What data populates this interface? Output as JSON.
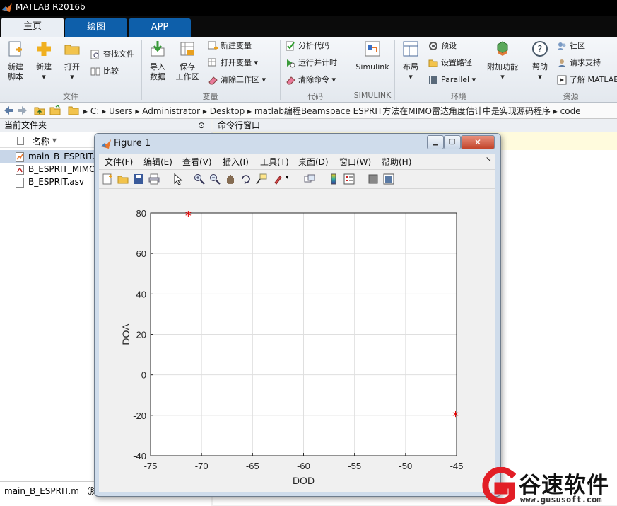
{
  "window": {
    "title": "MATLAB R2016b"
  },
  "tabs": [
    {
      "label": "主页"
    },
    {
      "label": "绘图"
    },
    {
      "label": "APP"
    }
  ],
  "ribbon": {
    "file": {
      "new_script": [
        "新建",
        "脚本"
      ],
      "new": "新建",
      "open": "打开",
      "find_files": "查找文件",
      "compare": "比较",
      "group": "文件"
    },
    "variable": {
      "import_data": [
        "导入",
        "数据"
      ],
      "save_workspace": [
        "保存",
        "工作区"
      ],
      "new_variable": "新建变量",
      "open_variable": "打开变量",
      "clear_workspace": "清除工作区",
      "group": "变量"
    },
    "code": {
      "analyze_code": "分析代码",
      "run_and_time": "运行并计时",
      "clear_commands": "清除命令",
      "group": "代码"
    },
    "simulink": {
      "simulink": "Simulink",
      "group": "SIMULINK"
    },
    "environment": {
      "layout": "布局",
      "preferences": "预设",
      "set_path": "设置路径",
      "parallel": "Parallel",
      "addons": "附加功能",
      "group": "环境"
    },
    "resources": {
      "help": "帮助",
      "community": "社区",
      "request_support": "请求支持",
      "learn_matlab": "了解 MATLAB",
      "group": "资源"
    }
  },
  "address": {
    "crumbs": [
      "C:",
      "Users",
      "Administrator",
      "Desktop",
      "matlab编程Beamspace ESPRIT方法在MIMO雷达角度估计中是实现源码程序",
      "code"
    ]
  },
  "current_folder": {
    "title": "当前文件夹",
    "column": "名称",
    "files": [
      {
        "name": "main_B_ESPRIT.m",
        "icon": "m-file-icon",
        "selected": true
      },
      {
        "name": "B_ESPRIT_MIMO",
        "icon": "pdf-file-icon"
      },
      {
        "name": "B_ESPRIT.asv",
        "icon": "blank-file-icon"
      }
    ],
    "details": "main_B_ESPRIT.m （脚本"
  },
  "command_window": {
    "title": "命令行窗口"
  },
  "figure": {
    "title": "Figure 1",
    "menu": [
      "文件(F)",
      "编辑(E)",
      "查看(V)",
      "插入(I)",
      "工具(T)",
      "桌面(D)",
      "窗口(W)",
      "帮助(H)"
    ]
  },
  "chart_data": {
    "type": "scatter",
    "title": "",
    "xlabel": "DOD",
    "ylabel": "DOA",
    "xlim": [
      -75,
      -45
    ],
    "ylim": [
      -40,
      80
    ],
    "xticks": [
      -75,
      -70,
      -65,
      -60,
      -55,
      -50,
      -45
    ],
    "yticks": [
      80,
      60,
      40,
      20,
      0,
      -20,
      -40
    ],
    "grid": true,
    "marker": "*",
    "marker_color": "#e60000",
    "points": [
      {
        "x": -71.3,
        "y": 79
      },
      {
        "x": -45.1,
        "y": -20
      }
    ]
  },
  "watermark": {
    "brand": "谷速软件",
    "url": "www.gususoft.com"
  }
}
